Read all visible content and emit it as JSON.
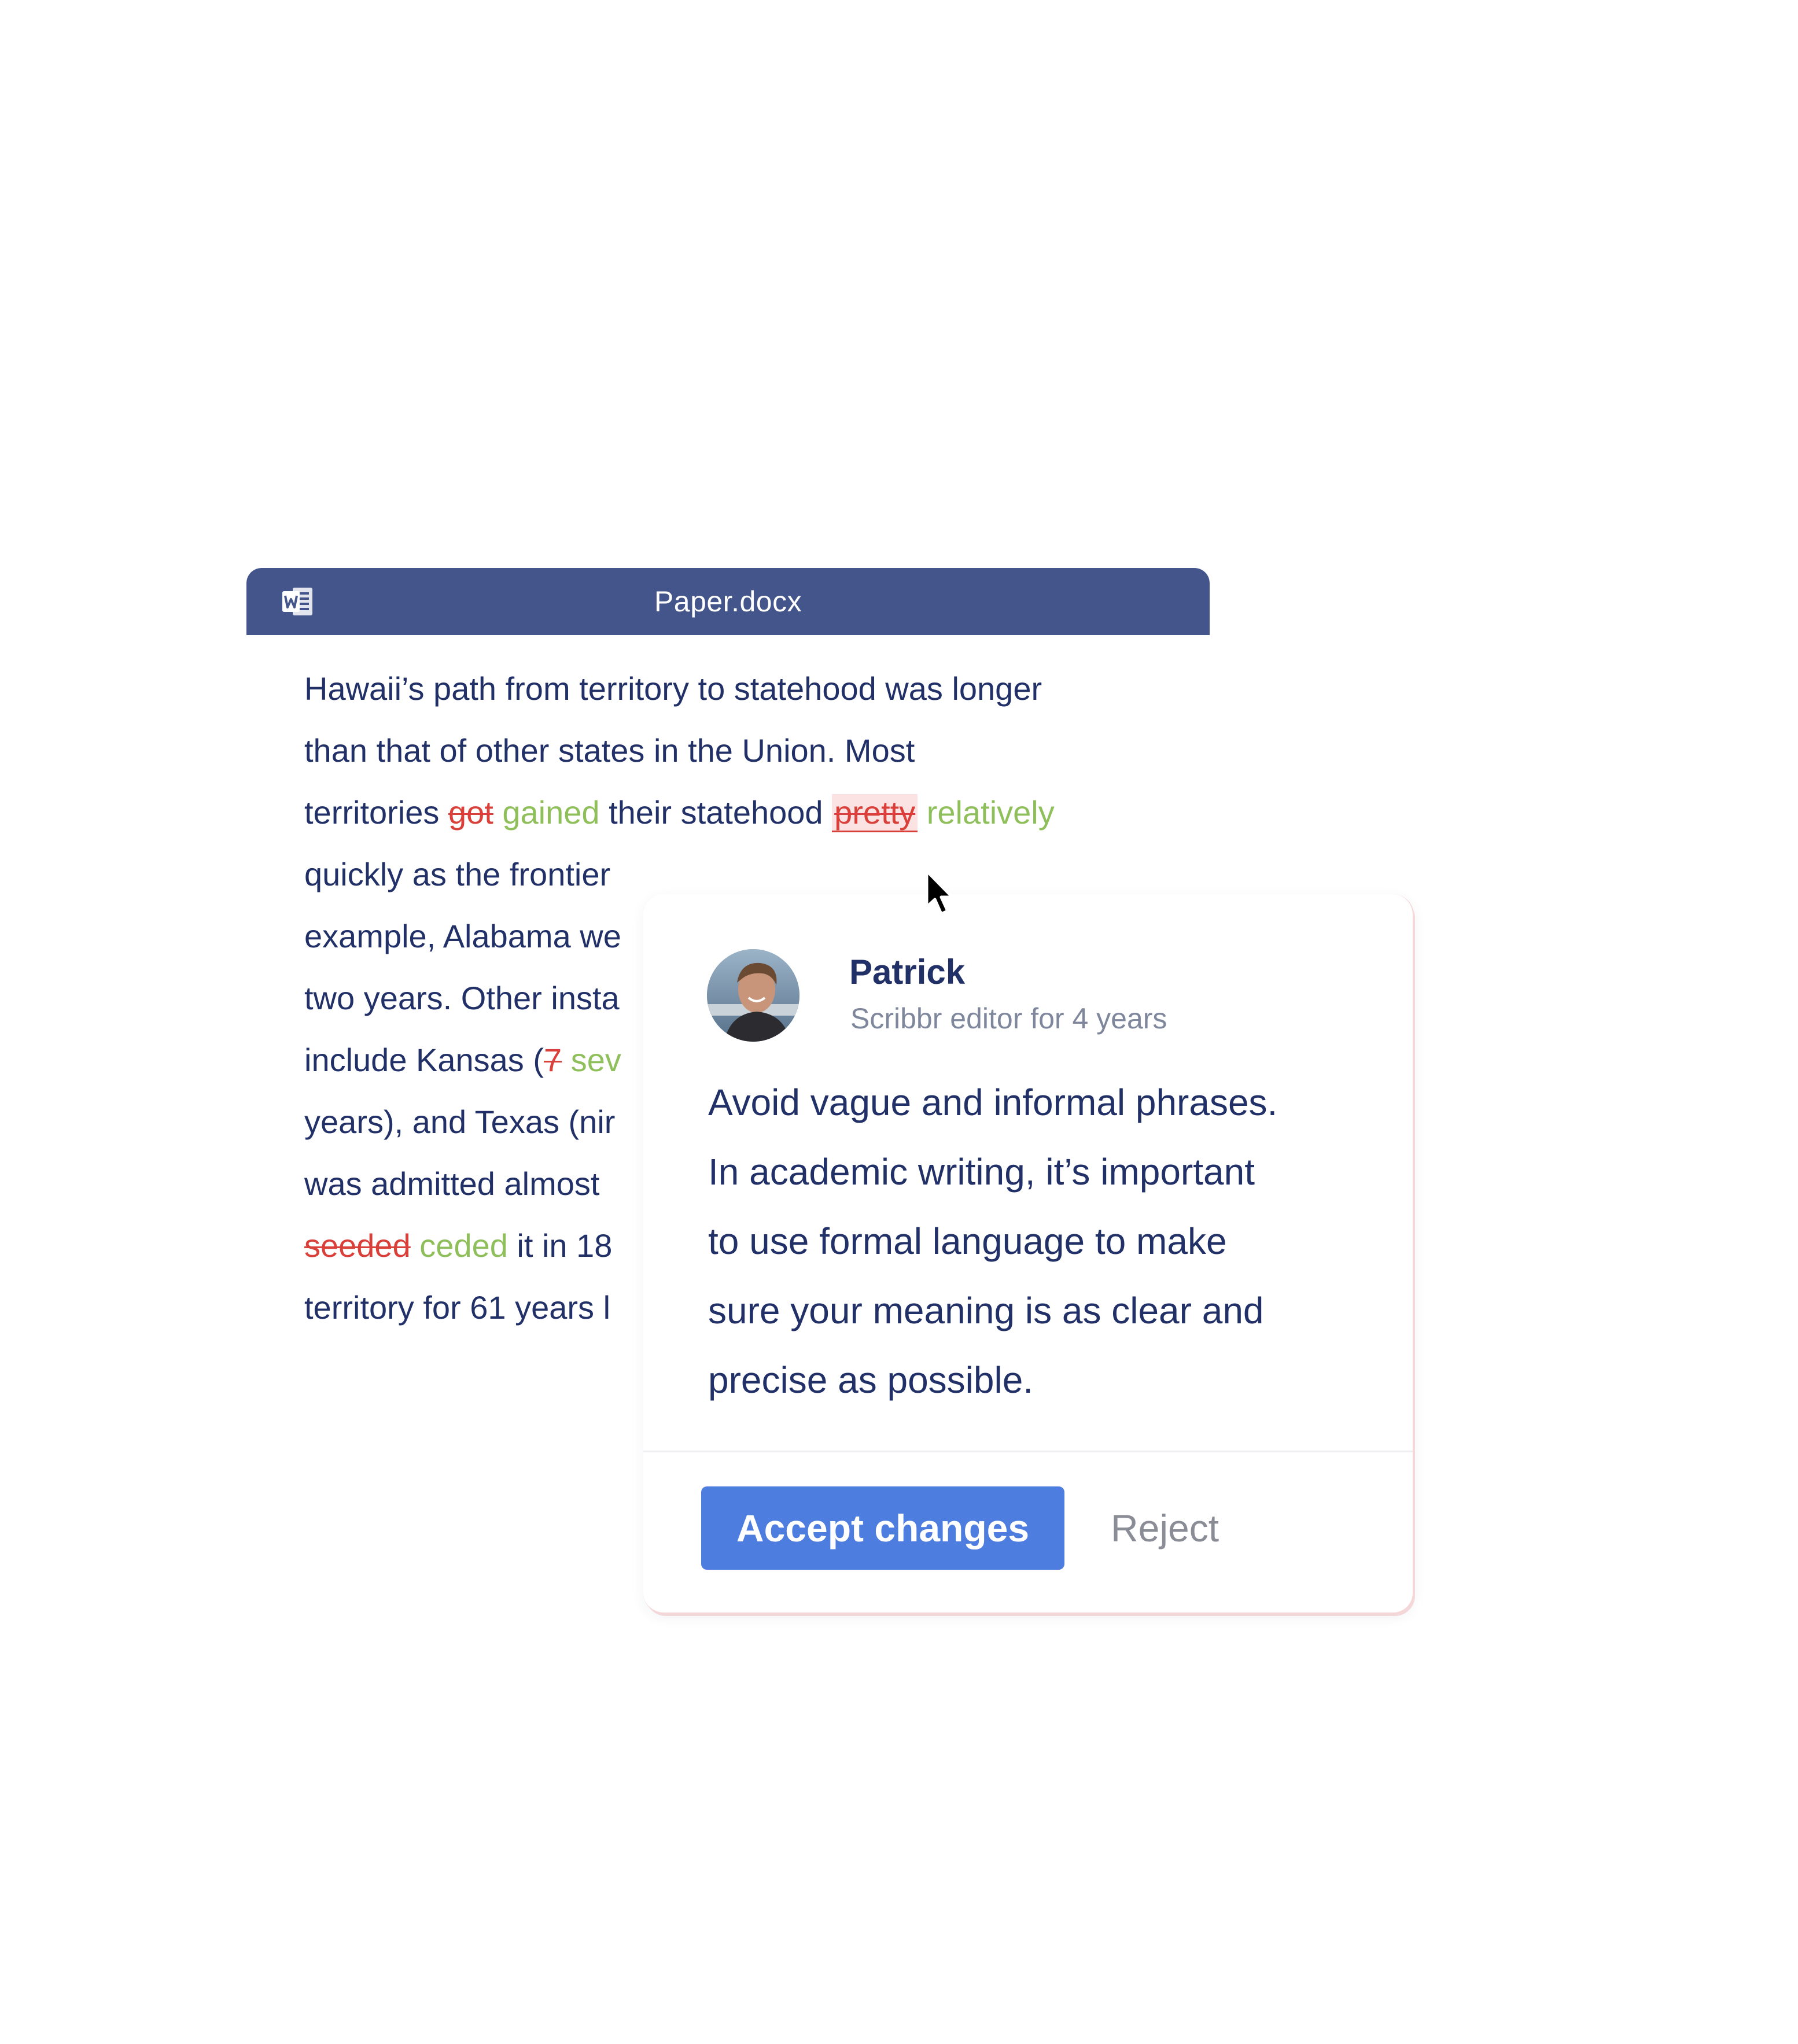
{
  "document": {
    "title": "Paper.docx",
    "icon": "word-document-icon",
    "lines": [
      [
        {
          "t": "Hawaii’s path from territory to statehood was longer",
          "k": "n"
        }
      ],
      [
        {
          "t": "than that of other states in the Union. Most",
          "k": "n"
        }
      ],
      [
        {
          "t": "territories ",
          "k": "n"
        },
        {
          "t": "got",
          "k": "del"
        },
        {
          "t": " ",
          "k": "n"
        },
        {
          "t": "gained",
          "k": "ins"
        },
        {
          "t": " their statehood ",
          "k": "n"
        },
        {
          "t": "pretty",
          "k": "hl"
        },
        {
          "t": " ",
          "k": "n"
        },
        {
          "t": "relatively",
          "k": "ins"
        }
      ],
      [
        {
          "t": "quickly as the frontier",
          "k": "n"
        }
      ],
      [
        {
          "t": "example, Alabama we",
          "k": "n"
        }
      ],
      [
        {
          "t": "two years. Other insta",
          "k": "n"
        }
      ],
      [
        {
          "t": "include Kansas (",
          "k": "n"
        },
        {
          "t": "7",
          "k": "del"
        },
        {
          "t": " ",
          "k": "n"
        },
        {
          "t": "sev",
          "k": "ins"
        }
      ],
      [
        {
          "t": "years), and Texas (nir",
          "k": "n"
        }
      ],
      [
        {
          "t": "was admitted almost",
          "k": "n"
        }
      ],
      [
        {
          "t": "seeded",
          "k": "del"
        },
        {
          "t": " ",
          "k": "n"
        },
        {
          "t": "ceded",
          "k": "ins"
        },
        {
          "t": " it in 18",
          "k": "n"
        }
      ],
      [
        {
          "t": "territory for 61 years l",
          "k": "n"
        }
      ]
    ]
  },
  "comment": {
    "reviewer_name": "Patrick",
    "reviewer_role": "Scribbr editor for 4 years",
    "text_lines": [
      "Avoid vague and informal phrases.",
      "In academic writing, it’s important",
      "to use formal language to make",
      "sure your meaning is as clear and",
      "precise as possible."
    ],
    "accept_label": "Accept changes",
    "reject_label": "Reject"
  },
  "colors": {
    "titlebar": "#44558b",
    "body_text": "#223068",
    "deletion": "#d9403a",
    "insertion": "#8fbf5a",
    "accept_button": "#4e7de0",
    "reject_text": "#8a8d96"
  }
}
